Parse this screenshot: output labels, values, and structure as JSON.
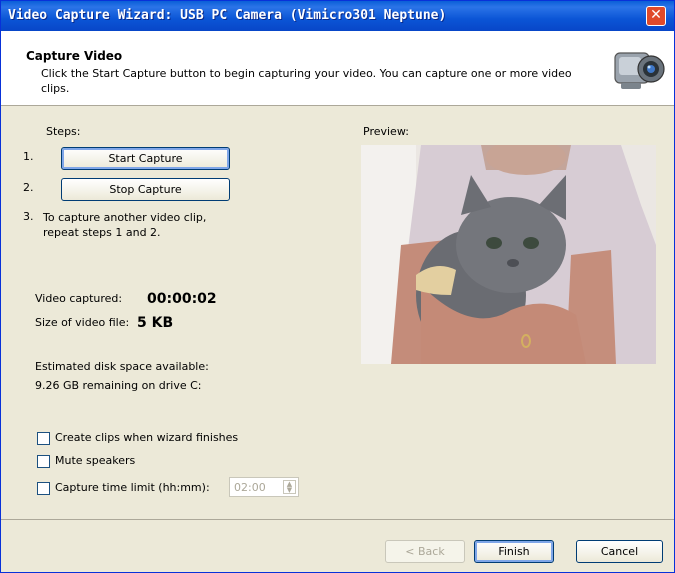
{
  "window": {
    "title": "Video Capture Wizard: USB PC Camera (Vimicro301 Neptune)",
    "close_symbol": "✕"
  },
  "header": {
    "title": "Capture Video",
    "description": "Click the Start Capture button to begin capturing your video. You can capture one or more video clips.",
    "icon": "camcorder-icon"
  },
  "steps": {
    "label": "Steps:",
    "step1_num": "1.",
    "start_button": "Start Capture",
    "step2_num": "2.",
    "stop_button": "Stop Capture",
    "step3_num": "3.",
    "step3_text": "To capture another video clip, repeat steps 1 and 2."
  },
  "preview": {
    "label": "Preview:"
  },
  "stats": {
    "video_captured_label": "Video captured:",
    "video_captured_value": "00:00:02",
    "size_label": "Size of video file:",
    "size_value": "5 KB",
    "disk_label": "Estimated disk space available:",
    "disk_value": "9.26 GB remaining on drive C:"
  },
  "options": {
    "create_clips": {
      "label": "Create clips when wizard finishes",
      "checked": false
    },
    "mute_speakers": {
      "label": "Mute speakers",
      "checked": false
    },
    "time_limit": {
      "label": "Capture time limit (hh:mm):",
      "checked": false,
      "value": "02:00"
    }
  },
  "footer": {
    "back": "< Back",
    "finish": "Finish",
    "cancel": "Cancel"
  },
  "colors": {
    "titlebar": "#0a5fd8",
    "close": "#e04a2a",
    "dialog_bg": "#ece9d8"
  }
}
